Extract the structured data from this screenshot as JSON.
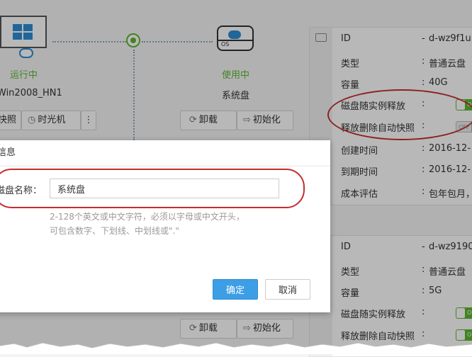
{
  "instance": {
    "status": "运行中",
    "name": "Win2008_HN1",
    "buttons": [
      "快照",
      "时光机"
    ],
    "more_icon": "vertical-ellipsis-icon"
  },
  "disk": {
    "status": "使用中",
    "name": "系统盘",
    "buttons": [
      "卸载",
      "初始化"
    ],
    "badge": "OS"
  },
  "detail_panel_1": {
    "rows": [
      {
        "label": "ID",
        "value": "d-wz9f1u"
      },
      {
        "label": "类型",
        "value": "普通云盘"
      },
      {
        "label": "容量",
        "value": "40G"
      },
      {
        "label": "磁盘随实例释放",
        "toggle": "ON"
      },
      {
        "label": "释放删除自动快照",
        "toggle": "OFF"
      },
      {
        "label": "创建时间",
        "value": "2016-12-"
      },
      {
        "label": "到期时间",
        "value": "2016-12-"
      },
      {
        "label": "成本评估",
        "value": "包年包月，"
      }
    ]
  },
  "detail_panel_2": {
    "rows": [
      {
        "label": "ID",
        "value": "d-wz9190"
      },
      {
        "label": "类型",
        "value": "普通云盘"
      },
      {
        "label": "容量",
        "value": "5G"
      },
      {
        "label": "磁盘随实例释放",
        "toggle": "ON"
      },
      {
        "label": "释放删除自动快照",
        "toggle": "ON"
      }
    ]
  },
  "lower_buttons": [
    "卸载",
    "初始化"
  ],
  "dialog": {
    "title": "信息",
    "field_label": "磁盘名称：",
    "field_value": "系统盘",
    "hint_line1": "2-128个英文或中文字符，必须以字母或中文开头，",
    "hint_line2": "可包含数字、下划线、中划线或\".\"",
    "ok_label": "确定",
    "cancel_label": "取消"
  },
  "colors": {
    "accent_blue": "#3c9ee5",
    "status_green": "#5cb630",
    "annotation_red": "#c62d2d"
  }
}
